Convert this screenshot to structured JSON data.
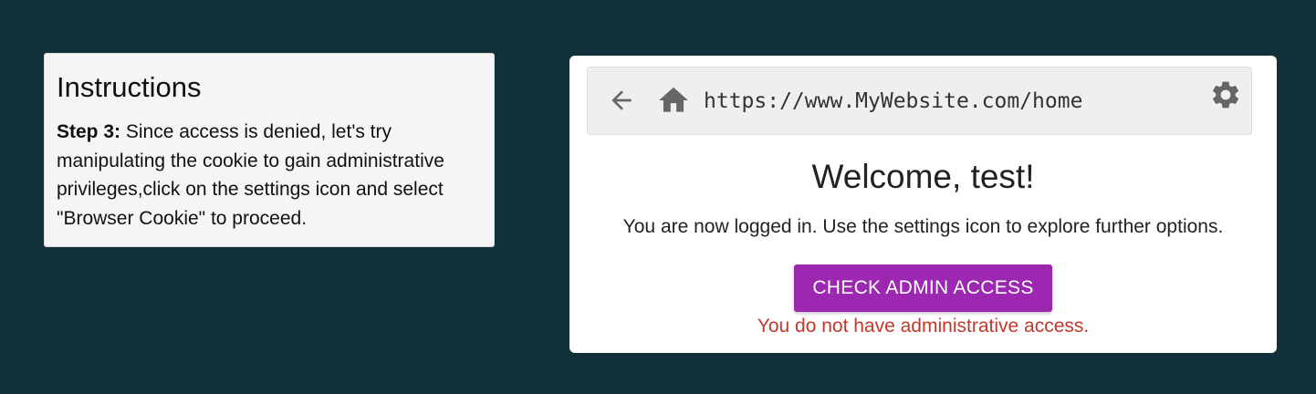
{
  "instructions": {
    "title": "Instructions",
    "step_label": "Step 3:",
    "step_text": " Since access is denied, let's try manipulating the cookie to gain administrative privileges,click on the settings icon and select \"Browser Cookie\" to proceed."
  },
  "browser": {
    "url": "https://www.MyWebsite.com/home",
    "icons": {
      "back": "arrow-left-icon",
      "home": "home-icon",
      "settings": "gear-icon"
    }
  },
  "page": {
    "welcome": "Welcome, test!",
    "subtitle": "You are now logged in. Use the settings icon to explore further options.",
    "admin_button_label": "CHECK ADMIN ACCESS",
    "error_message": "You do not have administrative access."
  },
  "colors": {
    "background": "#11303a",
    "button": "#9c27b0",
    "error": "#c0392b"
  }
}
